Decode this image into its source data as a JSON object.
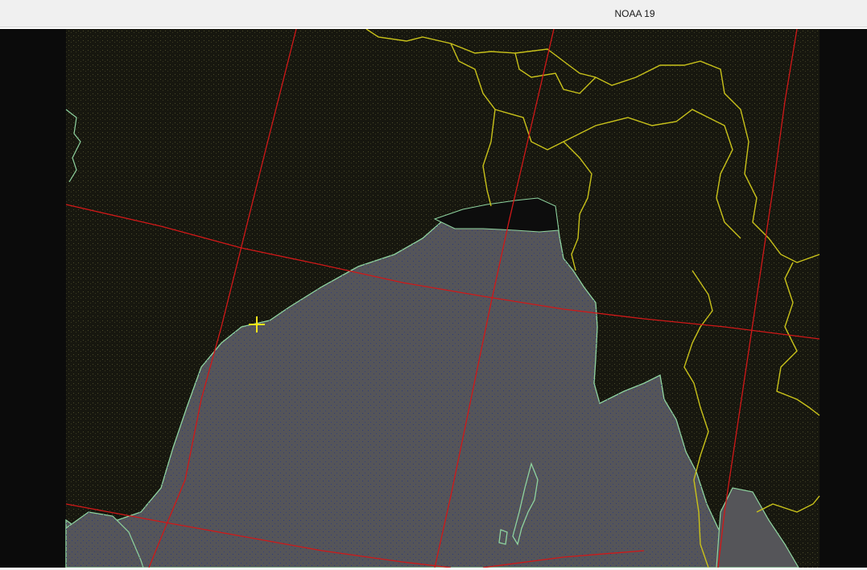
{
  "window": {
    "title": "NOAA 19"
  },
  "map": {
    "satellite": "NOAA 19",
    "colors": {
      "background": "#0a0a0a",
      "land": "#16160e",
      "sea": "#555559",
      "coastline": "#8fd4a0",
      "borders": "#c9c21a",
      "graticule": "#d01818",
      "marker": "#f5e51a"
    },
    "icons": {
      "marker": "crosshair-marker-icon"
    }
  }
}
